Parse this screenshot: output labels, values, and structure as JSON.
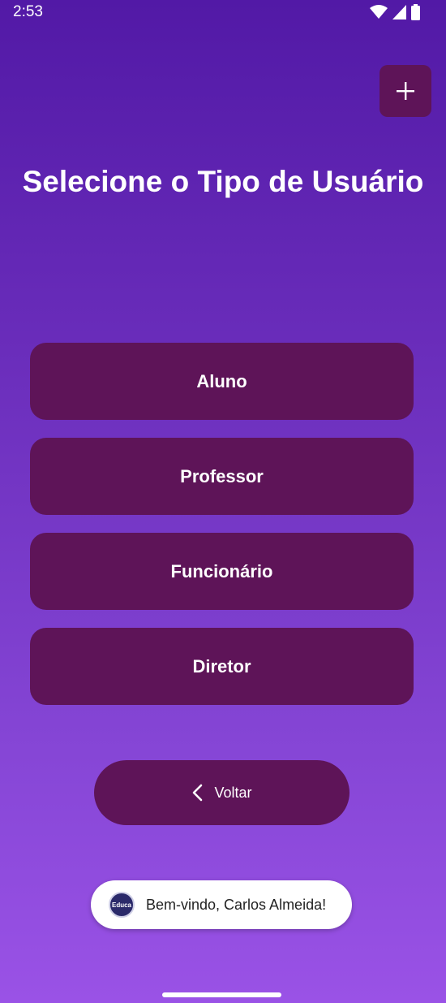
{
  "status_bar": {
    "time": "2:53"
  },
  "header": {
    "add_icon": "plus-icon"
  },
  "title": "Selecione o Tipo de Usuário",
  "roles": [
    {
      "label": "Aluno"
    },
    {
      "label": "Professor"
    },
    {
      "label": "Funcionário"
    },
    {
      "label": "Diretor"
    }
  ],
  "back_button": {
    "label": "Voltar",
    "icon": "chevron-left-icon"
  },
  "toast": {
    "logo_text": "Educa",
    "message": "Bem-vindo, Carlos Almeida!"
  },
  "colors": {
    "button_bg": "#5e1458",
    "gradient_top": "#5219a6",
    "gradient_bottom": "#9a52e6",
    "text": "#ffffff"
  }
}
